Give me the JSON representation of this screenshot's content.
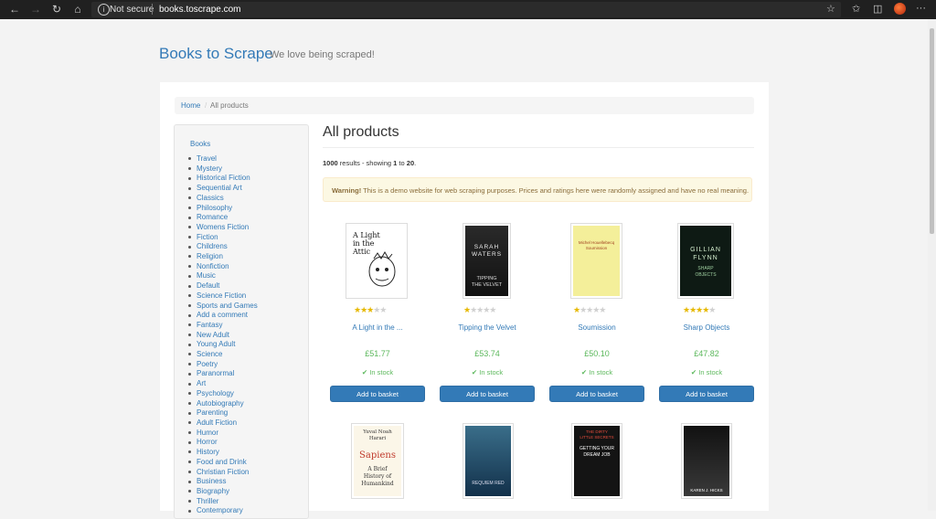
{
  "browser": {
    "security_label": "Not secure",
    "url": "books.toscrape.com"
  },
  "header": {
    "brand": "Books to Scrape",
    "tagline": "We love being scraped!"
  },
  "breadcrumb": {
    "home": "Home",
    "current": "All products"
  },
  "sidebar": {
    "heading": "Books",
    "categories": [
      "Travel",
      "Mystery",
      "Historical Fiction",
      "Sequential Art",
      "Classics",
      "Philosophy",
      "Romance",
      "Womens Fiction",
      "Fiction",
      "Childrens",
      "Religion",
      "Nonfiction",
      "Music",
      "Default",
      "Science Fiction",
      "Sports and Games",
      "Add a comment",
      "Fantasy",
      "New Adult",
      "Young Adult",
      "Science",
      "Poetry",
      "Paranormal",
      "Art",
      "Psychology",
      "Autobiography",
      "Parenting",
      "Adult Fiction",
      "Humor",
      "Horror",
      "History",
      "Food and Drink",
      "Christian Fiction",
      "Business",
      "Biography",
      "Thriller",
      "Contemporary"
    ]
  },
  "main": {
    "title": "All products",
    "results_count": "1000",
    "results_text": "results - showing",
    "results_from": "1",
    "results_to_word": "to",
    "results_to": "20",
    "warning_strong": "Warning!",
    "warning_text": "This is a demo website for web scraping purposes. Prices and ratings here were randomly assigned and have no real meaning."
  },
  "products": [
    {
      "title": "A Light in the ...",
      "price": "£51.77",
      "stock": "In stock",
      "button": "Add to basket",
      "rating": 3,
      "cover_lines": [
        "A Light",
        "in the",
        "Attic"
      ]
    },
    {
      "title": "Tipping the Velvet",
      "price": "£53.74",
      "stock": "In stock",
      "button": "Add to basket",
      "rating": 1,
      "cover_lines": [
        "SARAH",
        "WATERS",
        "TIPPING",
        "THE VELVET"
      ]
    },
    {
      "title": "Soumission",
      "price": "£50.10",
      "stock": "In stock",
      "button": "Add to basket",
      "rating": 1,
      "cover_lines": [
        "Michel Houellebecq",
        "Soumission"
      ]
    },
    {
      "title": "Sharp Objects",
      "price": "£47.82",
      "stock": "In stock",
      "button": "Add to basket",
      "rating": 4,
      "cover_lines": [
        "GILLIAN",
        "FLYNN",
        "SHARP",
        "OBJECTS"
      ]
    }
  ],
  "products_row2": [
    {
      "cover_lines": [
        "Yuval Noah",
        "Harari",
        "Sapiens",
        "A Brief",
        "History of",
        "Humankind"
      ]
    },
    {
      "cover_lines": [
        "REQUIEM RED"
      ]
    },
    {
      "cover_lines": [
        "THE DIRTY",
        "LITTLE SECRETS",
        "GETTING YOUR",
        "DREAM JOB"
      ]
    },
    {
      "cover_lines": [
        "KAREN J. HICKS"
      ]
    }
  ]
}
